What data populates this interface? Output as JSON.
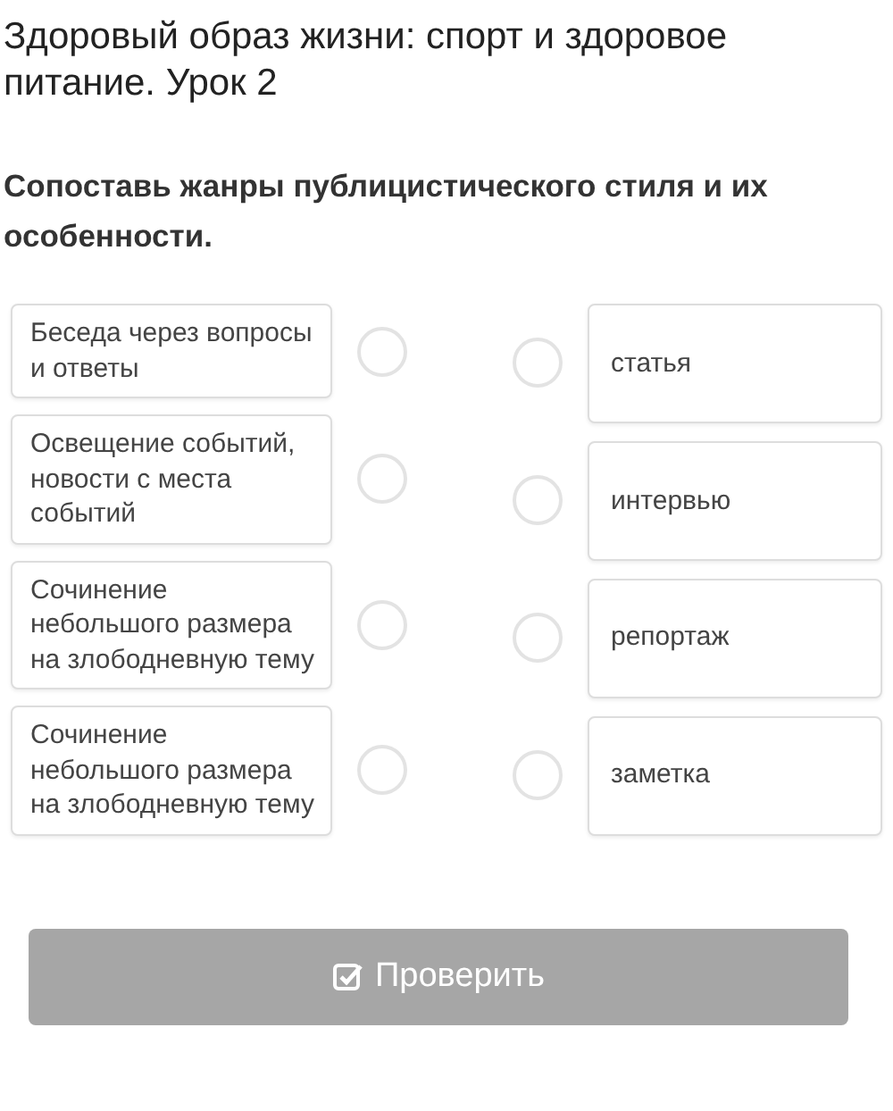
{
  "lesson_title": "Здоровый образ жизни: спорт и здоровое питание. Урок 2",
  "question": "Сопоставь жанры публицистического стиля и их особенности.",
  "left_items": [
    {
      "text": "Беседа через вопросы и ответы"
    },
    {
      "text": "Освещение событий, новости с места событий"
    },
    {
      "text": "Сочинение небольшого размера на злободневную тему"
    },
    {
      "text": "Сочинение небольшого размера на злободневную тему"
    }
  ],
  "right_items": [
    {
      "text": "статья"
    },
    {
      "text": "интервью"
    },
    {
      "text": "репортаж"
    },
    {
      "text": "заметка"
    }
  ],
  "check_button": {
    "label": "Проверить",
    "disabled": true
  }
}
